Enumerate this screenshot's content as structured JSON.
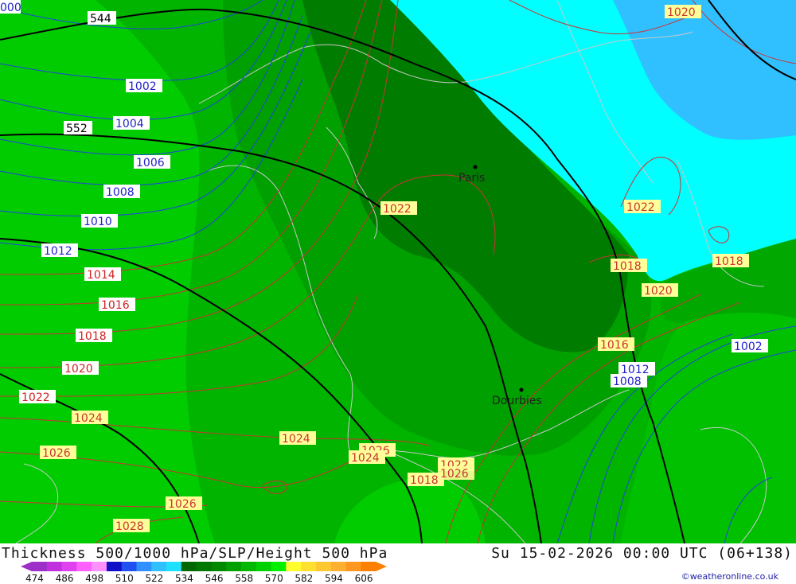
{
  "map": {
    "cities": [
      {
        "name": "Paris"
      },
      {
        "name": "Dourbies"
      }
    ],
    "height_labels": [
      "544",
      "552"
    ],
    "slp_labels_blue": [
      "000",
      "1002",
      "1004",
      "1006",
      "1008",
      "1010",
      "1012",
      "1012",
      "1008",
      "1002"
    ],
    "slp_labels_red": [
      "1014",
      "1016",
      "1018",
      "1020",
      "1022"
    ],
    "slp_labels_yellow": [
      "1020",
      "1022",
      "1022",
      "1018",
      "1018",
      "1020",
      "1016",
      "1024",
      "1024",
      "1026",
      "1024",
      "1026",
      "1018",
      "1022",
      "1026",
      "1026",
      "1028"
    ],
    "colors": {
      "thickness_558": "#00d000",
      "thickness_552": "#00b800",
      "thickness_546": "#00a000",
      "thickness_540": "#007800",
      "thickness_528": "#00ffff",
      "thickness_522": "#30c8ff",
      "slp_low": "#2244dd",
      "slp_high": "#cc3333",
      "height500": "#000000"
    }
  },
  "footer": {
    "title": "Thickness 500/1000 hPa/SLP/Height 500 hPa",
    "date": "Su 15-02-2026 00:00 UTC (06+138)",
    "credit": "©weatheronline.co.uk",
    "scale_values": [
      "474",
      "486",
      "498",
      "510",
      "522",
      "534",
      "546",
      "558",
      "570",
      "582",
      "594",
      "606"
    ],
    "scale_colors": [
      "#9c30c8",
      "#c030e0",
      "#e040f0",
      "#ff60ff",
      "#ff90ff",
      "#1010c8",
      "#2050f0",
      "#3090ff",
      "#30c0ff",
      "#20e0ff",
      "#006800",
      "#007800",
      "#008800",
      "#00a000",
      "#00b800",
      "#00d000",
      "#00f000",
      "#ffff30",
      "#ffe030",
      "#ffc830",
      "#ffb030",
      "#ff9820",
      "#ff8000"
    ]
  }
}
